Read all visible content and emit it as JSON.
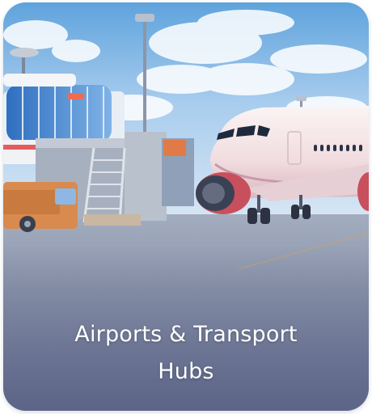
{
  "card": {
    "title_line1": "Airports & Transport",
    "title_line2": "Hubs"
  }
}
